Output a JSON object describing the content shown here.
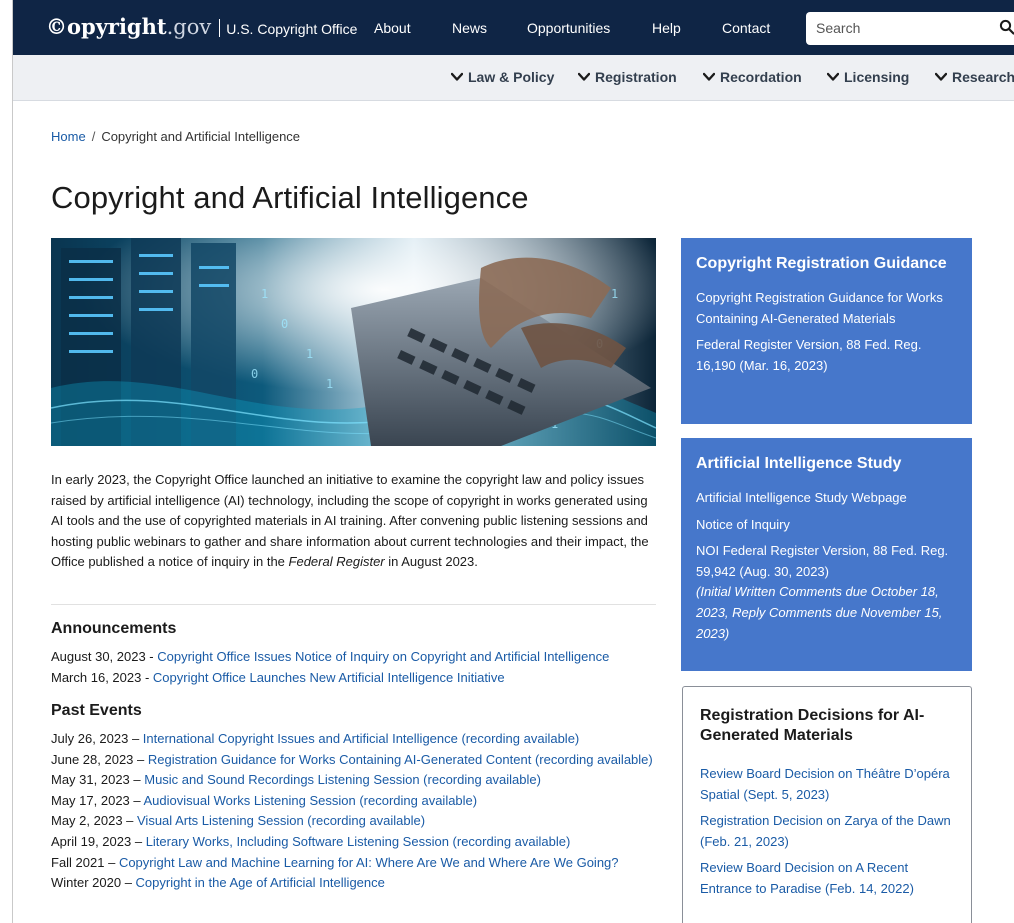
{
  "header": {
    "logo_main": "©opyright",
    "logo_domain": ".gov",
    "office_name": "U.S. Copyright Office",
    "nav": [
      {
        "label": "About"
      },
      {
        "label": "News"
      },
      {
        "label": "Opportunities"
      },
      {
        "label": "Help"
      },
      {
        "label": "Contact"
      }
    ],
    "search": {
      "placeholder": "Search",
      "icon": "search-icon"
    },
    "colors": {
      "primary": "#0f2545",
      "subnav_bg": "#eef0f3"
    }
  },
  "subnav": [
    {
      "label": "Law & Policy",
      "icon": "chevron-down-icon"
    },
    {
      "label": "Registration",
      "icon": "chevron-down-icon"
    },
    {
      "label": "Recordation",
      "icon": "chevron-down-icon"
    },
    {
      "label": "Licensing",
      "icon": "chevron-down-icon"
    },
    {
      "label": "Research",
      "icon": "chevron-down-icon"
    }
  ],
  "breadcrumb": {
    "home": "Home",
    "separator": "/",
    "current": "Copyright and Artificial Intelligence"
  },
  "page_title": "Copyright and Artificial Intelligence",
  "intro": {
    "text_before": "In early 2023, the Copyright Office launched an initiative to examine the copyright law and policy issues raised by artificial intelligence (AI) technology, including the scope of copyright in works generated using AI tools and the use of copyrighted materials in AI training. After convening public listening sessions and hosting public webinars to gather and share information about current technologies and their impact, the Office published a notice of inquiry in the ",
    "emphasis": "Federal Register",
    "text_after": " in August 2023."
  },
  "announcements": {
    "heading": "Announcements",
    "items": [
      {
        "date": "August 30, 2023 - ",
        "link": "Copyright Office Issues Notice of Inquiry on Copyright and Artificial Intelligence"
      },
      {
        "date": "March 16, 2023 - ",
        "link": "Copyright Office Launches New Artificial Intelligence Initiative"
      }
    ]
  },
  "past_events": {
    "heading": "Past Events",
    "items": [
      {
        "date": "July 26, 2023 – ",
        "link": "International Copyright Issues and Artificial Intelligence (recording available)"
      },
      {
        "date": "June 28, 2023 – ",
        "link": "Registration Guidance for Works Containing AI-Generated Content (recording available)"
      },
      {
        "date": "May 31, 2023 – ",
        "link": "Music and Sound Recordings Listening Session (recording available)"
      },
      {
        "date": "May 17, 2023 – ",
        "link": "Audiovisual Works Listening Session (recording available)"
      },
      {
        "date": "May 2, 2023 – ",
        "link": "Visual Arts Listening Session (recording available)"
      },
      {
        "date": "April 19, 2023 – ",
        "link": "Literary Works, Including Software Listening Session (recording available)"
      },
      {
        "date": "Fall 2021 – ",
        "link": "Copyright Law and Machine Learning for AI: Where Are We and Where Are We Going?"
      },
      {
        "date": "Winter 2020 – ",
        "link": "Copyright in the Age of Artificial Intelligence"
      }
    ]
  },
  "sidebar": {
    "card_color": "#4677cb",
    "registration_guidance": {
      "title": "Copyright Registration Guidance",
      "items": [
        "Copyright Registration Guidance for Works Containing AI-Generated Materials",
        "Federal Register Version, 88 Fed. Reg. 16,190 (Mar. 16, 2023)"
      ]
    },
    "ai_study": {
      "title": "Artificial Intelligence Study",
      "items": [
        "Artificial Intelligence Study Webpage",
        "Notice of Inquiry",
        "NOI Federal Register Version, 88 Fed. Reg. 59,942 (Aug. 30, 2023)"
      ],
      "note": "(Initial Written Comments due October 18, 2023, Reply Comments due November 15, 2023)"
    },
    "registration_decisions": {
      "title": "Registration Decisions for AI-Generated Materials",
      "items": [
        "Review Board Decision on Théâtre D’opéra Spatial (Sept. 5, 2023)",
        "Registration Decision on Zarya of the Dawn (Feb. 21, 2023)",
        "Review Board Decision on A Recent Entrance to Paradise (Feb. 14, 2022)"
      ]
    }
  }
}
